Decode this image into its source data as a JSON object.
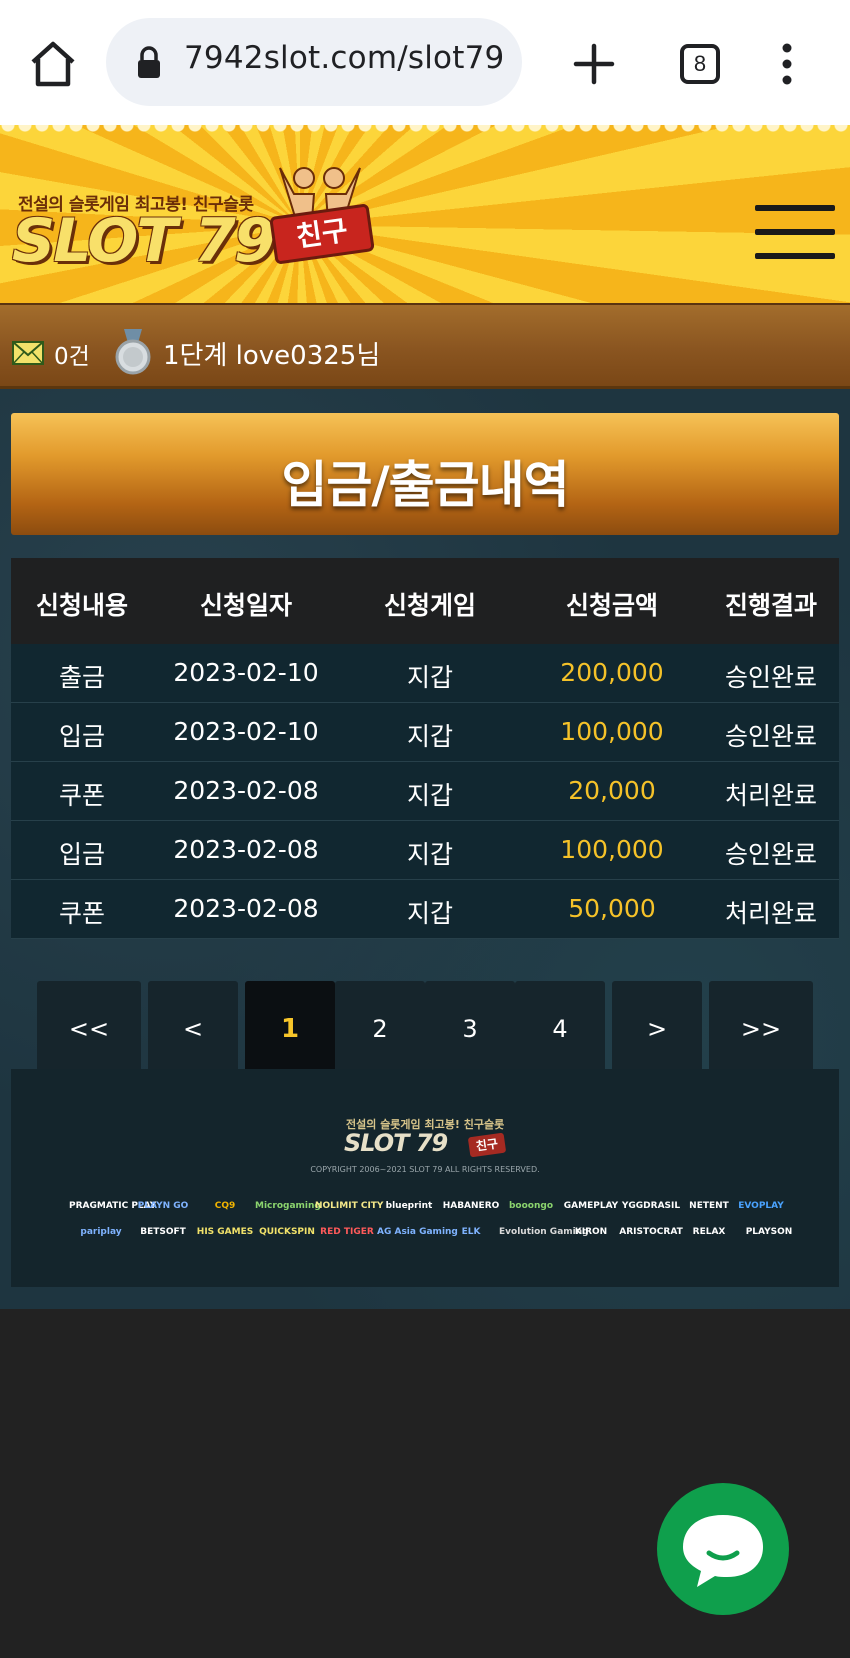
{
  "browser": {
    "url": "7942slot.com/slot79",
    "tab_count": "8"
  },
  "site": {
    "tagline": "전설의 슬롯게임 최고봉! 친구슬롯",
    "logo_text": "SLOT 79",
    "logo_badge": "친구"
  },
  "user_bar": {
    "mail_count": "0건",
    "level_user": "1단계 love0325님"
  },
  "page": {
    "title": "입금/출금내역"
  },
  "table": {
    "headers": [
      "신청내용",
      "신청일자",
      "신청게임",
      "신청금액",
      "진행결과"
    ],
    "rows": [
      {
        "type": "출금",
        "date": "2023-02-10",
        "game": "지갑",
        "amount": "200,000",
        "result": "승인완료"
      },
      {
        "type": "입금",
        "date": "2023-02-10",
        "game": "지갑",
        "amount": "100,000",
        "result": "승인완료"
      },
      {
        "type": "쿠폰",
        "date": "2023-02-08",
        "game": "지갑",
        "amount": "20,000",
        "result": "처리완료"
      },
      {
        "type": "입금",
        "date": "2023-02-08",
        "game": "지갑",
        "amount": "100,000",
        "result": "승인완료"
      },
      {
        "type": "쿠폰",
        "date": "2023-02-08",
        "game": "지갑",
        "amount": "50,000",
        "result": "처리완료"
      }
    ]
  },
  "pagination": {
    "first": "<<",
    "prev": "<",
    "pages": [
      "1",
      "2",
      "3",
      "4"
    ],
    "current": "1",
    "next": ">",
    "last": ">>"
  },
  "footer": {
    "tagline": "전설의 슬롯게임 최고봉! 친구슬롯",
    "logo_text": "SLOT 79",
    "logo_badge": "친구",
    "copyright": "COPYRIGHT  2006~2021 SLOT 79 ALL RIGHTS RESERVED.",
    "providers_row1": [
      "PRAGMATIC PLAY",
      "PLAYN GO",
      "CQ9",
      "Microgaming",
      "NOLIMIT CITY",
      "blueprint",
      "HABANERO",
      "booongo",
      "GAMEPLAY",
      "YGGDRASIL",
      "NETENT",
      "EVOPLAY"
    ],
    "providers_row2": [
      "pariplay",
      "BETSOFT",
      "HIS GAMES",
      "QUICKSPIN",
      "RED TIGER",
      "AG Asia Gaming",
      "ELK",
      "Evolution Gaming",
      "KIRON",
      "ARISTOCRAT",
      "RELAX",
      "PLAYSON"
    ]
  },
  "colors": {
    "amount": "#f5c229",
    "chat_button": "#0f9f4c",
    "title_bar": "#e29a2c"
  }
}
